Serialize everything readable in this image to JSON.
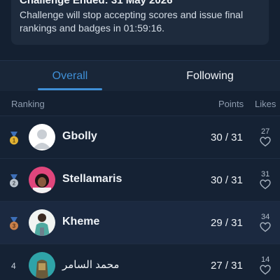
{
  "banner": {
    "title": "Challenge Ended: 31 May 2026",
    "body": "Challenge will stop accepting scores and issue final rankings and badges in 01:59:16."
  },
  "tabs": [
    {
      "label": "Overall",
      "active": true
    },
    {
      "label": "Following",
      "active": false
    }
  ],
  "table": {
    "headers": {
      "ranking": "Ranking",
      "points": "Points",
      "likes": "Likes"
    },
    "rows": [
      {
        "rank": "1",
        "medal": "gold",
        "name": "Gbolly",
        "points": "30 / 31",
        "likes": "27"
      },
      {
        "rank": "2",
        "medal": "silver",
        "name": "Stellamaris",
        "points": "30 / 31",
        "likes": "31"
      },
      {
        "rank": "3",
        "medal": "bronze",
        "name": "Kheme",
        "points": "29 / 31",
        "likes": "34"
      },
      {
        "rank": "4",
        "medal": null,
        "name": "محمد السامر",
        "points": "27 / 31",
        "likes": "14"
      }
    ]
  },
  "colors": {
    "accent": "#3f8fd6",
    "background": "#142031",
    "gold": "#e2b233",
    "silver": "#b9c2cc",
    "bronze": "#c9804a"
  },
  "icons": {
    "medal": "medal-icon",
    "like": "heart-outline-icon",
    "default_avatar": "default-avatar-icon"
  }
}
